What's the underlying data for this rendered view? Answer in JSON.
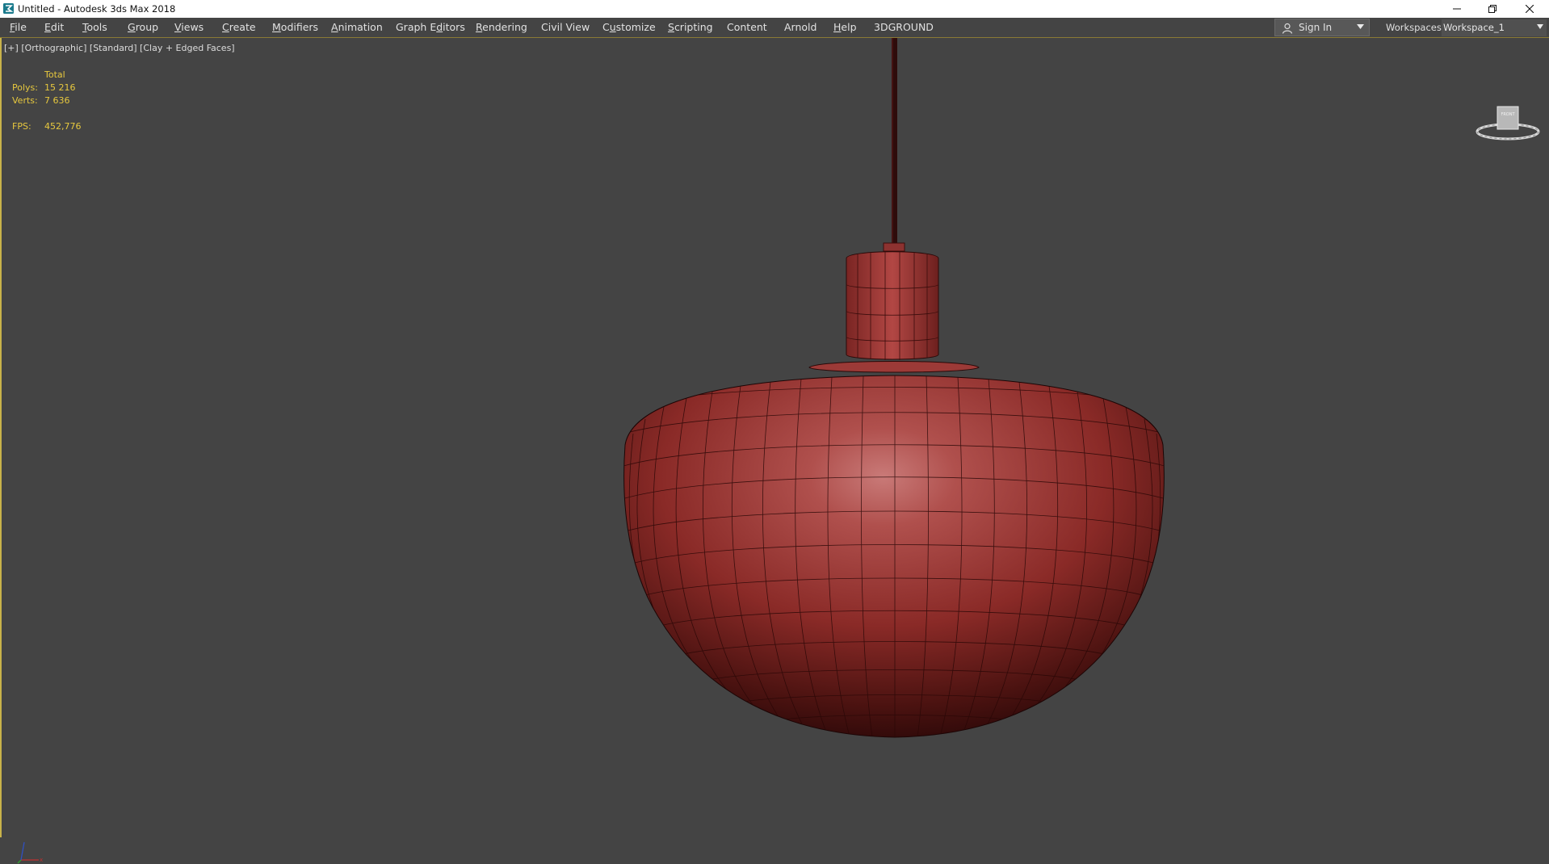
{
  "window": {
    "title": "Untitled - Autodesk 3ds Max 2018",
    "app_icon": "3ds-max-icon",
    "controls": [
      "minimize-icon",
      "restore-icon",
      "close-icon"
    ]
  },
  "menubar": {
    "items": [
      {
        "pre": "",
        "mn": "F",
        "post": "ile"
      },
      {
        "pre": "",
        "mn": "E",
        "post": "dit"
      },
      {
        "pre": "",
        "mn": "T",
        "post": "ools"
      },
      {
        "pre": "",
        "mn": "G",
        "post": "roup"
      },
      {
        "pre": "",
        "mn": "V",
        "post": "iews"
      },
      {
        "pre": "",
        "mn": "C",
        "post": "reate"
      },
      {
        "pre": "",
        "mn": "M",
        "post": "odifiers"
      },
      {
        "pre": "",
        "mn": "A",
        "post": "nimation"
      },
      {
        "pre": "Graph E",
        "mn": "d",
        "post": "itors"
      },
      {
        "pre": "",
        "mn": "R",
        "post": "endering"
      },
      {
        "pre": "Civil View",
        "mn": "",
        "post": ""
      },
      {
        "pre": "C",
        "mn": "u",
        "post": "stomize"
      },
      {
        "pre": "",
        "mn": "S",
        "post": "cripting"
      },
      {
        "pre": "Content",
        "mn": "",
        "post": ""
      },
      {
        "pre": "Arnold",
        "mn": "",
        "post": ""
      },
      {
        "pre": "",
        "mn": "H",
        "post": "elp"
      },
      {
        "pre": "3DGROUND",
        "mn": "",
        "post": ""
      }
    ],
    "sign_in": "Sign In",
    "workspaces_label": "Workspaces:",
    "workspace_value": "Workspace_1"
  },
  "viewport": {
    "label_plus": "[+]",
    "label_view": "[Orthographic]",
    "label_shading_std": "[Standard]",
    "label_shading_mode": "[Clay + Edged Faces]",
    "stats": {
      "header": "Total",
      "polys_label": "Polys:",
      "polys_value": "15 216",
      "verts_label": "Verts:",
      "verts_value": "7 636",
      "fps_label": "FPS:",
      "fps_value": "452,776"
    },
    "viewcube_face": "FRONT",
    "model_color": "#b5403e",
    "stats_color": "#e7c83e",
    "frame_color": "#c8b24a"
  }
}
